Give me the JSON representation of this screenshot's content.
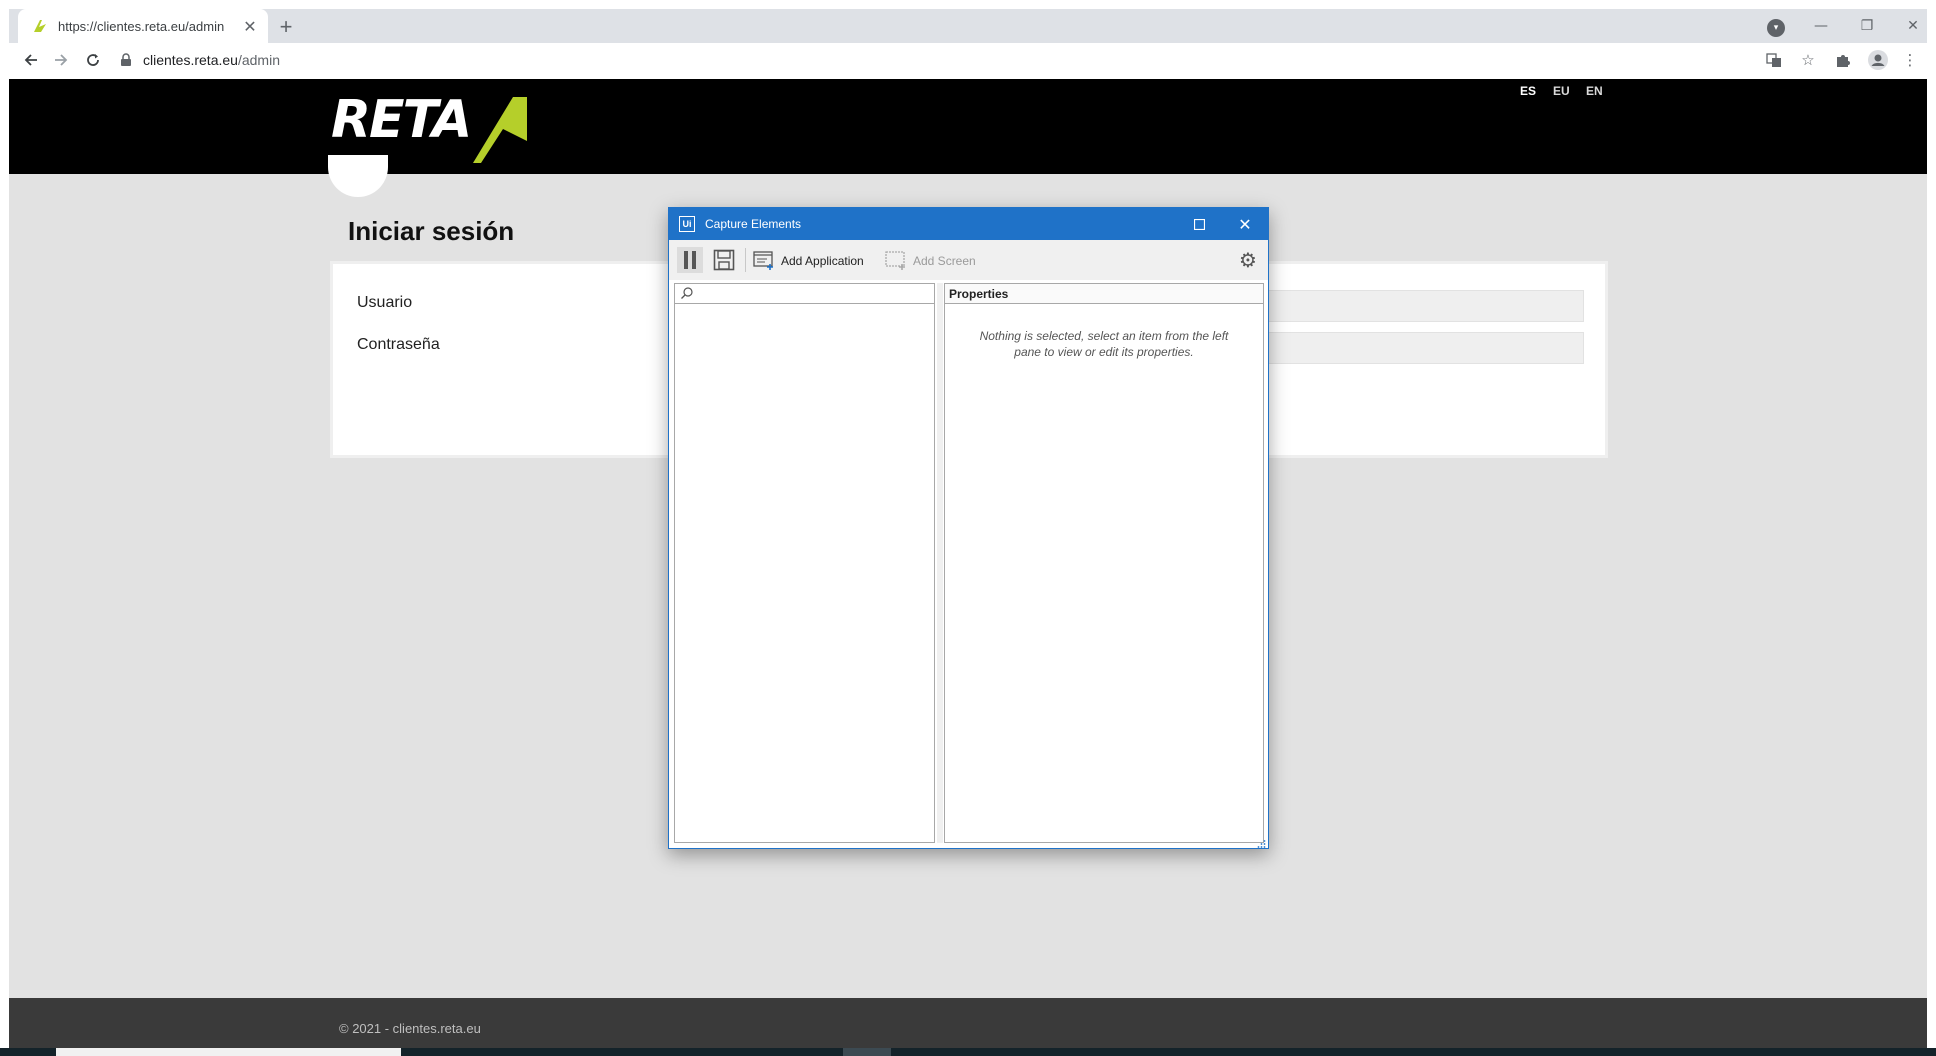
{
  "browser": {
    "tab_title": "https://clientes.reta.eu/admin",
    "tab_close": "✕",
    "new_tab": "+",
    "url_host": "clientes.reta.eu",
    "url_path": "/admin",
    "window_controls": {
      "minimize": "—",
      "restore": "❐",
      "close": "✕"
    }
  },
  "site": {
    "logo_text": "RETA",
    "languages": [
      "ES",
      "EU",
      "EN"
    ],
    "active_language": "ES",
    "login_title": "Iniciar sesión",
    "username_label": "Usuario",
    "password_label": "Contraseña",
    "footer": "© 2021 - clientes.reta.eu"
  },
  "dialog": {
    "app_icon_text": "Ui",
    "title": "Capture Elements",
    "add_application_label": "Add Application",
    "add_screen_label": "Add Screen",
    "properties_header": "Properties",
    "empty_message": "Nothing is selected, select an item from the left pane to view or edit its properties."
  },
  "colors": {
    "accent_green": "#b5cf2a",
    "dialog_blue": "#1f72c8",
    "header_black": "#000000",
    "page_gray": "#e2e2e2",
    "footer_gray": "#3a3a3a"
  },
  "icons": {
    "favicon": "reta-leaf-icon",
    "back": "arrow-left-icon",
    "forward": "arrow-right-icon",
    "reload": "reload-icon",
    "lock": "lock-icon",
    "translate": "translate-icon",
    "bookmark": "star-icon",
    "extensions": "puzzle-icon",
    "profile": "profile-icon",
    "menu": "kebab-menu-icon"
  }
}
